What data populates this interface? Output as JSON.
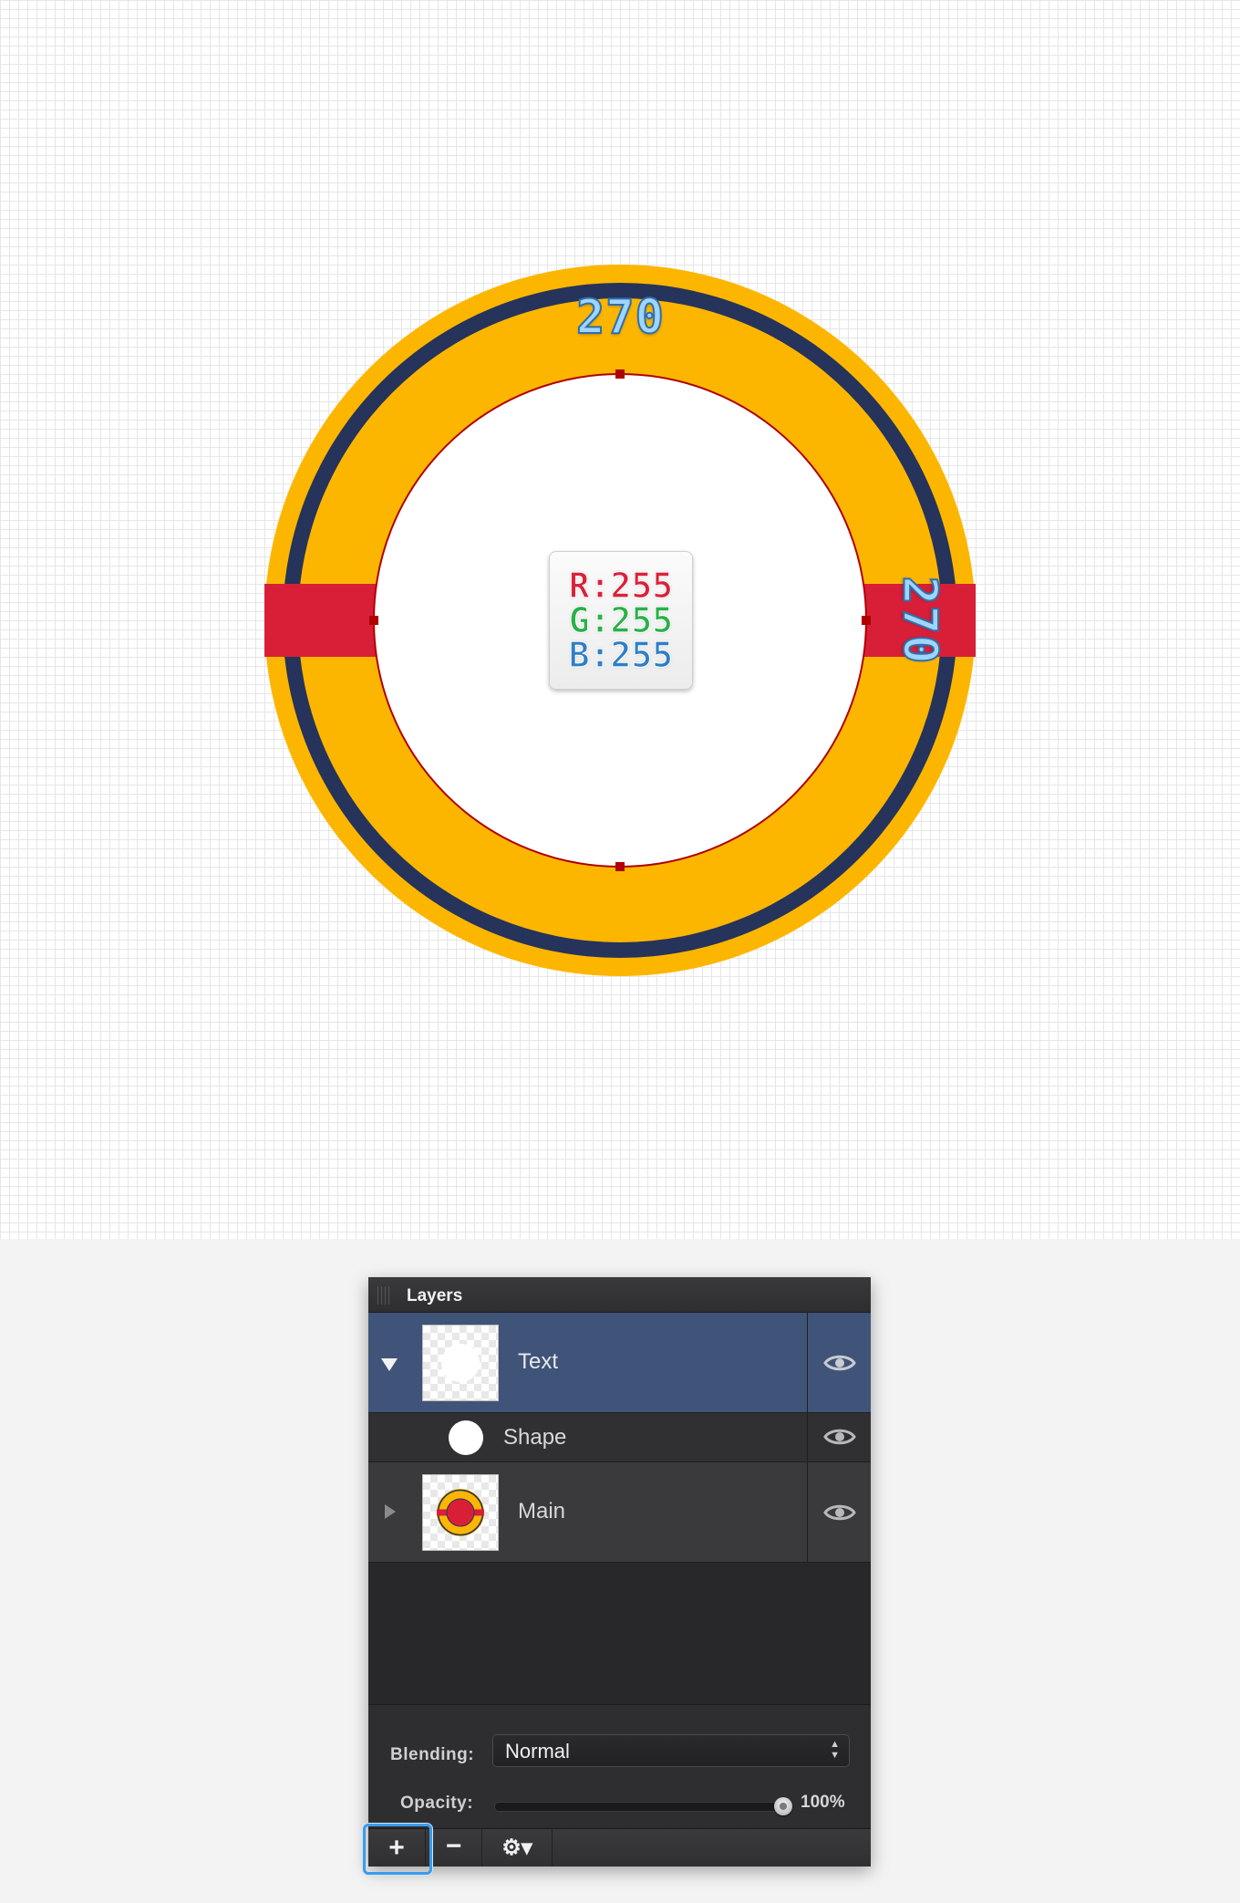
{
  "canvas": {
    "dimension_top": "270",
    "dimension_right": "270",
    "color_readout": {
      "r": "R:255",
      "g": "G:255",
      "b": "B:255"
    }
  },
  "colors": {
    "outer_ring": "#FDB600",
    "navy_ring": "#26335A",
    "red_band": "#D91F38",
    "inner_circle": "#FFFFFF",
    "selection": "#B00000",
    "selected_layer_row": "#3F5478"
  },
  "layers_panel": {
    "title": "Layers",
    "layers": [
      {
        "name": "Text",
        "expanded": true,
        "selected": true,
        "thumbnail": "transparent-with-white-circle",
        "visible": true
      },
      {
        "name": "Shape",
        "child": true,
        "thumbnail": "white-circle",
        "visible": true
      },
      {
        "name": "Main",
        "expanded": false,
        "thumbnail": "badge-art",
        "visible": true
      }
    ],
    "blending_label": "Blending:",
    "blending_value": "Normal",
    "opacity_label": "Opacity:",
    "opacity_value": "100%",
    "opacity": 1.0,
    "toolbar": {
      "add_label": "+",
      "remove_label": "−",
      "settings_label": "⚙▾"
    },
    "icons": [
      "eye-icon",
      "disclosure-triangle-icon",
      "gear-icon",
      "grip-icon"
    ]
  }
}
